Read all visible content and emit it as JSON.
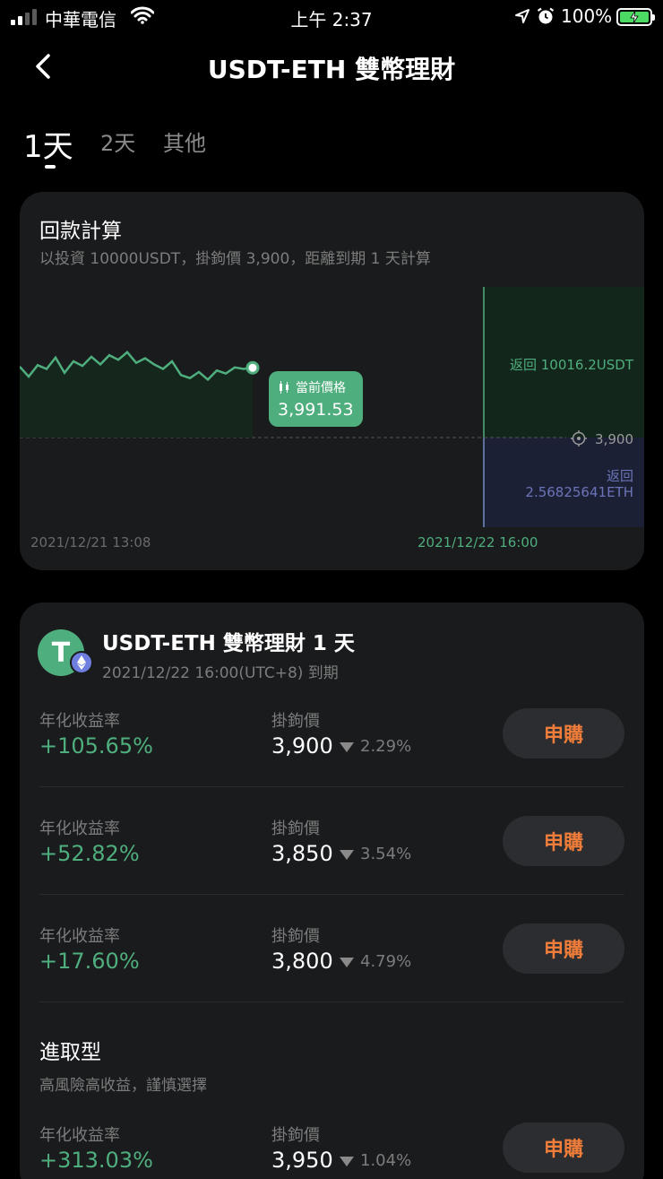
{
  "status_bar": {
    "carrier": "中華電信",
    "time": "上午 2:37",
    "battery": "100%",
    "signal_bars": 2
  },
  "header": {
    "title": "USDT-ETH 雙幣理財"
  },
  "tabs": [
    {
      "label": "1天",
      "active": true
    },
    {
      "label": "2天",
      "active": false
    },
    {
      "label": "其他",
      "active": false
    }
  ],
  "calc_card": {
    "title": "回款計算",
    "subtitle": "以投資 10000USDT，掛鉤價 3,900，距離到期 1 天計算",
    "current_price_label": "當前價格",
    "current_price": "3,991.53",
    "return_usdt": "返回 10016.2USDT",
    "strike_label": "3,900",
    "return_eth_label": "返回",
    "return_eth": "2.56825641ETH",
    "start_date": "2021/12/21 13:08",
    "end_date": "2021/12/22 16:00"
  },
  "chart_data": {
    "type": "line",
    "x_start": "2021/12/21 13:08",
    "x_end": "2021/12/22 16:00",
    "y": [
      3993,
      3980,
      3995,
      3990,
      4005,
      3985,
      4000,
      3994,
      4006,
      3996,
      4008,
      4002,
      4012,
      3998,
      4004,
      3996,
      3990,
      4000,
      3982,
      3978,
      3986,
      3976,
      3988,
      3984,
      3992,
      3990,
      3991.53
    ],
    "current": 3991.53,
    "strike": 3900,
    "colors": {
      "line": "#4fae7d",
      "usdt_zone": "#13261c",
      "eth_zone": "#1c2035"
    }
  },
  "product": {
    "coin": "T",
    "title": "USDT-ETH 雙幣理財 1 天",
    "subtitle": "2021/12/22 16:00(UTC+8) 到期",
    "apy_label": "年化收益率",
    "strike_label": "掛鉤價",
    "button_label": "申購",
    "rows": [
      {
        "apy": "+105.65%",
        "strike": "3,900",
        "pct": "2.29%"
      },
      {
        "apy": "+52.82%",
        "strike": "3,850",
        "pct": "3.54%"
      },
      {
        "apy": "+17.60%",
        "strike": "3,800",
        "pct": "4.79%"
      }
    ],
    "aggressive": {
      "title": "進取型",
      "subtitle": "高風險高收益，謹慎選擇",
      "rows": [
        {
          "apy": "+313.03%",
          "strike": "3,950",
          "pct": "1.04%"
        }
      ]
    }
  }
}
